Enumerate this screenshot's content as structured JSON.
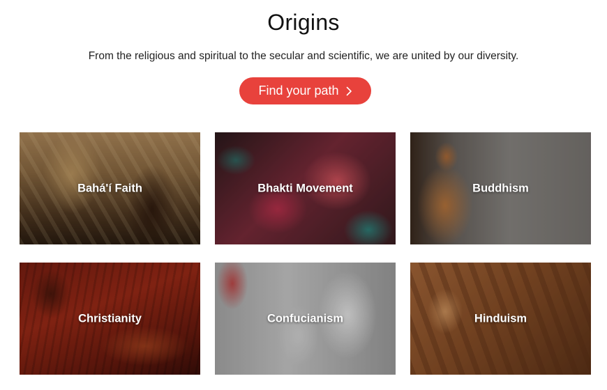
{
  "header": {
    "title": "Origins",
    "subtitle": "From the religious and spiritual to the secular and scientific, we are united by our diversity.",
    "cta_label": "Find your path",
    "cta_icon": "chevron-right-icon",
    "accent_color": "#e8423c"
  },
  "tiles": [
    {
      "label": "Bahá'í Faith"
    },
    {
      "label": "Bhakti Movement"
    },
    {
      "label": "Buddhism"
    },
    {
      "label": "Christianity"
    },
    {
      "label": "Confucianism"
    },
    {
      "label": "Hinduism"
    }
  ]
}
